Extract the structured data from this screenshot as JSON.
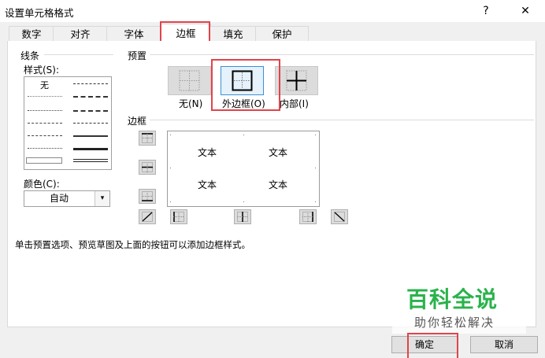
{
  "window": {
    "title": "设置单元格格式",
    "help_label": "?",
    "close_label": "✕"
  },
  "tabs": [
    {
      "label": "数字"
    },
    {
      "label": "对齐"
    },
    {
      "label": "字体"
    },
    {
      "label": "边框",
      "active": true
    },
    {
      "label": "填充"
    },
    {
      "label": "保护"
    }
  ],
  "line": {
    "group_label": "线条",
    "style_label": "样式(S):",
    "style_none": "无",
    "color_label": "颜色(C):",
    "color_value": "自动"
  },
  "presets": {
    "group_label": "预置",
    "items": [
      {
        "label": "无(N)",
        "icon": "border-none-icon"
      },
      {
        "label": "外边框(O)",
        "icon": "border-outline-icon",
        "selected": true
      },
      {
        "label": "内部(I)",
        "icon": "border-inside-icon"
      }
    ]
  },
  "border": {
    "group_label": "边框",
    "preview_texts": [
      "文本",
      "文本",
      "文本",
      "文本"
    ]
  },
  "hint": "单击预置选项、预览草图及上面的按钮可以添加边框样式。",
  "buttons": {
    "ok": "确定",
    "cancel": "取消"
  },
  "watermark": {
    "main": "百科全说",
    "sub": "助你轻松解决"
  },
  "colors": {
    "highlight": "#e2434a",
    "watermark_green": "#2bb24c",
    "selected_border": "#3c8fd6"
  }
}
